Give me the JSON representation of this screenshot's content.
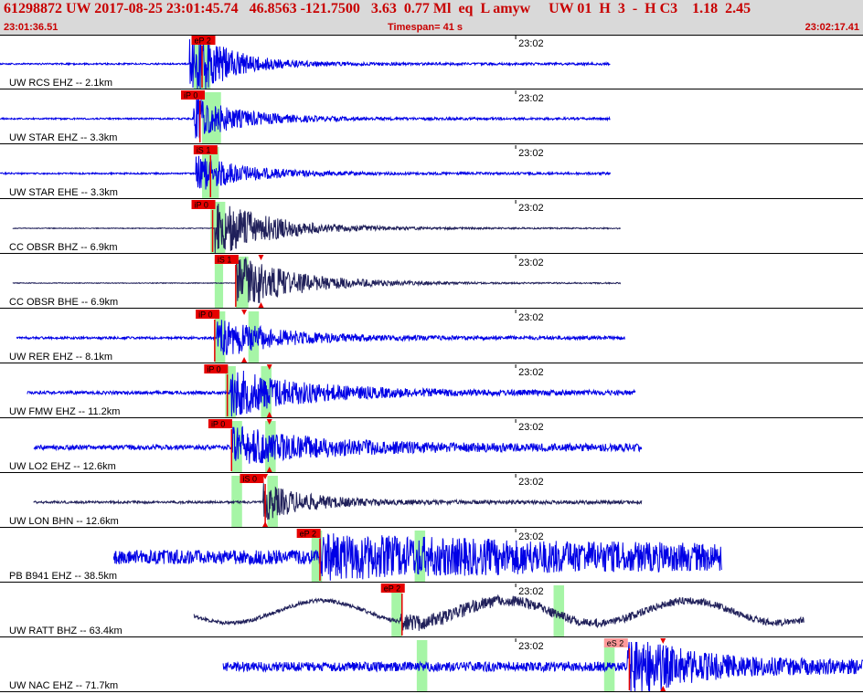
{
  "header": {
    "title": "61298872 UW 2017-08-25 23:01:45.74   46.8563 -121.7500   3.63  0.77 Ml  eq  L amyw     UW 01  H  3  -  H C3    1.18  2.45",
    "start_time": "23:01:36.51",
    "timespan": "Timespan=  41 s",
    "end_time": "23:02:17.41"
  },
  "colors": {
    "trace_blue": "#0000e6",
    "trace_dark": "#20205a",
    "pick_red": "#e60000",
    "pick_pink": "#ff9a9a",
    "window_green": "#a6f5a6"
  },
  "chart_data": {
    "type": "line",
    "title": "",
    "xlabel": "",
    "ylabel": "",
    "time_tick": "23:02",
    "xlim_seconds": [
      0,
      41
    ],
    "traces": [
      {
        "label": "UW RCS EHZ -- 2.1km",
        "color": "blue",
        "start": 0.0,
        "end": 29.0,
        "onset": 9.0,
        "amp": 1.0,
        "decay": 4,
        "noise": 0.02,
        "freq": 1.5,
        "pick": {
          "text": "eP 2",
          "t": 9.1,
          "kind": "red"
        },
        "greens": [
          9.2,
          10.0
        ],
        "red_lines": [
          9.6
        ]
      },
      {
        "label": "UW STAR EHZ -- 3.3km",
        "color": "blue",
        "start": 0.0,
        "end": 29.0,
        "onset": 9.2,
        "amp": 0.55,
        "decay": 5,
        "noise": 0.02,
        "freq": 1.6,
        "pick": {
          "text": "iP 0",
          "t": 8.6,
          "kind": "red"
        },
        "greens": [
          9.6,
          10.5
        ],
        "red_lines": [
          9.5
        ]
      },
      {
        "label": "UW STAR EHE -- 3.3km",
        "color": "blue",
        "start": 0.0,
        "end": 29.0,
        "onset": 9.3,
        "amp": 0.5,
        "decay": 5,
        "noise": 0.02,
        "freq": 1.6,
        "pick": {
          "text": "iS 1",
          "t": 9.2,
          "kind": "red"
        },
        "greens": [
          9.6,
          10.4
        ],
        "red_lines": [
          10.0
        ]
      },
      {
        "label": "CC OBSR BHZ -- 6.9km",
        "color": "dark",
        "start": 0.6,
        "end": 29.5,
        "onset": 10.2,
        "amp": 0.75,
        "decay": 6,
        "noise": 0.01,
        "freq": 1.1,
        "pick": {
          "text": "iP 0",
          "t": 9.1,
          "kind": "red"
        },
        "greens": [
          10.0,
          10.7
        ],
        "red_lines": [
          10.1
        ]
      },
      {
        "label": "CC OBSR BHE -- 6.9km",
        "color": "dark",
        "start": 0.6,
        "end": 29.5,
        "onset": 11.2,
        "amp": 0.75,
        "decay": 6,
        "noise": 0.01,
        "freq": 1.1,
        "pick": {
          "text": "iS 1",
          "t": 10.2,
          "kind": "red"
        },
        "greens": [
          10.2,
          10.6,
          11.2,
          11.8
        ],
        "red_lines": [
          11.2
        ],
        "triangles": [
          12.4
        ]
      },
      {
        "label": "UW RER EHZ -- 8.1km",
        "color": "blue",
        "start": 0.8,
        "end": 29.7,
        "onset": 10.3,
        "amp": 0.55,
        "decay": 6,
        "noise": 0.03,
        "freq": 1.4,
        "pick": {
          "text": "iP 0",
          "t": 9.3,
          "kind": "red"
        },
        "greens": [
          10.2,
          10.7,
          11.8,
          12.3
        ],
        "red_lines": [
          10.2
        ],
        "triangles": [
          11.6
        ]
      },
      {
        "label": "UW FMW EHZ -- 11.2km",
        "color": "blue",
        "start": 1.3,
        "end": 30.2,
        "onset": 10.9,
        "amp": 0.6,
        "decay": 8,
        "noise": 0.04,
        "freq": 1.4,
        "pick": {
          "text": "iP 0",
          "t": 9.7,
          "kind": "red"
        },
        "greens": [
          10.7,
          11.2,
          12.4,
          12.9
        ],
        "red_lines": [
          10.8
        ],
        "triangles": [
          12.8
        ]
      },
      {
        "label": "UW LO2 EHZ -- 12.6km",
        "color": "blue",
        "start": 1.6,
        "end": 30.5,
        "onset": 11.0,
        "amp": 0.5,
        "decay": 9,
        "noise": 0.06,
        "freq": 1.4,
        "pick": {
          "text": "iP 0",
          "t": 9.9,
          "kind": "red"
        },
        "greens": [
          11.0,
          11.5,
          12.6,
          13.1
        ],
        "red_lines": [
          11.0
        ],
        "triangles": [
          12.8
        ]
      },
      {
        "label": "UW LON BHN -- 12.6km",
        "color": "dark",
        "start": 1.6,
        "end": 30.5,
        "onset": 12.5,
        "amp": 0.45,
        "decay": 5,
        "noise": 0.03,
        "freq": 1.2,
        "pick": {
          "text": "iS 0",
          "t": 11.4,
          "kind": "red"
        },
        "greens": [
          11.0,
          11.5,
          12.7,
          13.2
        ],
        "red_lines": [
          12.6
        ],
        "triangles": [
          12.6
        ]
      },
      {
        "label": "PB B941 EHZ -- 38.5km",
        "color": "blue",
        "start": 5.4,
        "end": 34.3,
        "onset": 15.2,
        "amp": 0.35,
        "decay": 30,
        "noise": 0.18,
        "freq": 1.6,
        "pick": {
          "text": "eP 2",
          "t": 14.1,
          "kind": "red"
        },
        "greens": [
          14.8,
          15.3,
          19.7,
          20.2
        ],
        "red_lines": [
          15.2
        ]
      },
      {
        "label": "UW RATT BHZ -- 63.4km",
        "color": "dark",
        "start": 9.2,
        "end": 38.2,
        "onset": 19.0,
        "amp": 0.15,
        "decay": 15,
        "noise": 0.05,
        "freq": 1.3,
        "swell": 0.3,
        "pick": {
          "text": "eP 2",
          "t": 18.1,
          "kind": "red"
        },
        "greens": [
          18.6,
          19.1,
          26.3,
          26.8
        ],
        "red_lines": [
          19.1
        ]
      },
      {
        "label": "UW NAC EHZ -- 71.7km",
        "color": "blue",
        "start": 10.6,
        "end": 41.0,
        "onset": 29.8,
        "amp": 0.75,
        "decay": 6,
        "noise": 0.12,
        "freq": 1.7,
        "pick": {
          "text": "eS 2",
          "t": 28.7,
          "kind": "pink"
        },
        "greens": [
          19.8,
          20.3,
          28.7,
          29.2
        ],
        "red_lines": [
          29.9
        ],
        "triangles": [
          31.5
        ]
      }
    ]
  }
}
